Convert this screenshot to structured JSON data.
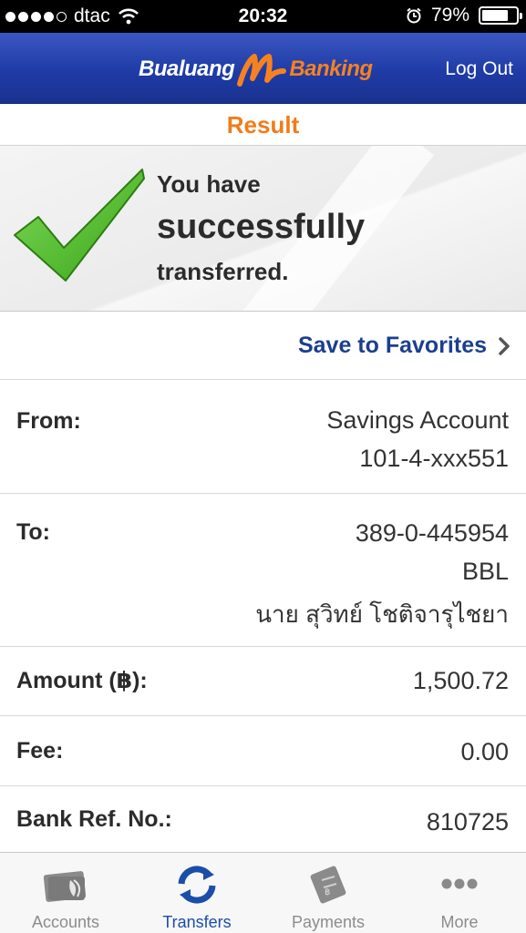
{
  "status_bar": {
    "carrier": "dtac",
    "time": "20:32",
    "battery": "79%",
    "battery_level": 0.79
  },
  "nav": {
    "logo_left": "Bualuang",
    "logo_right": "Banking",
    "logout_label": "Log Out"
  },
  "result": {
    "title": "Result",
    "line1": "You have",
    "line2": "successfully",
    "line3": "transferred."
  },
  "favorites": {
    "label": "Save to Favorites"
  },
  "details": {
    "from_label": "From:",
    "from_account_type": "Savings Account",
    "from_account_no": "101-4-xxx551",
    "to_label": "To:",
    "to_account_no": "389-0-445954",
    "to_bank": "BBL",
    "to_name": "นาย สุวิทย์ โชติจารุไชยา",
    "amount_label": "Amount (฿):",
    "amount_value": "1,500.72",
    "fee_label": "Fee:",
    "fee_value": "0.00",
    "ref_label": "Bank Ref. No.:",
    "ref_value": "810725"
  },
  "tabs": [
    {
      "label": "Accounts",
      "icon": "accounts-icon",
      "active": false
    },
    {
      "label": "Transfers",
      "icon": "transfers-icon",
      "active": true
    },
    {
      "label": "Payments",
      "icon": "payments-icon",
      "active": false
    },
    {
      "label": "More",
      "icon": "more-icon",
      "active": false
    }
  ],
  "colors": {
    "nav_blue": "#1f3ba6",
    "accent_orange": "#f07c1c",
    "link_blue": "#1b3f8f",
    "check_green": "#5cc21f"
  }
}
